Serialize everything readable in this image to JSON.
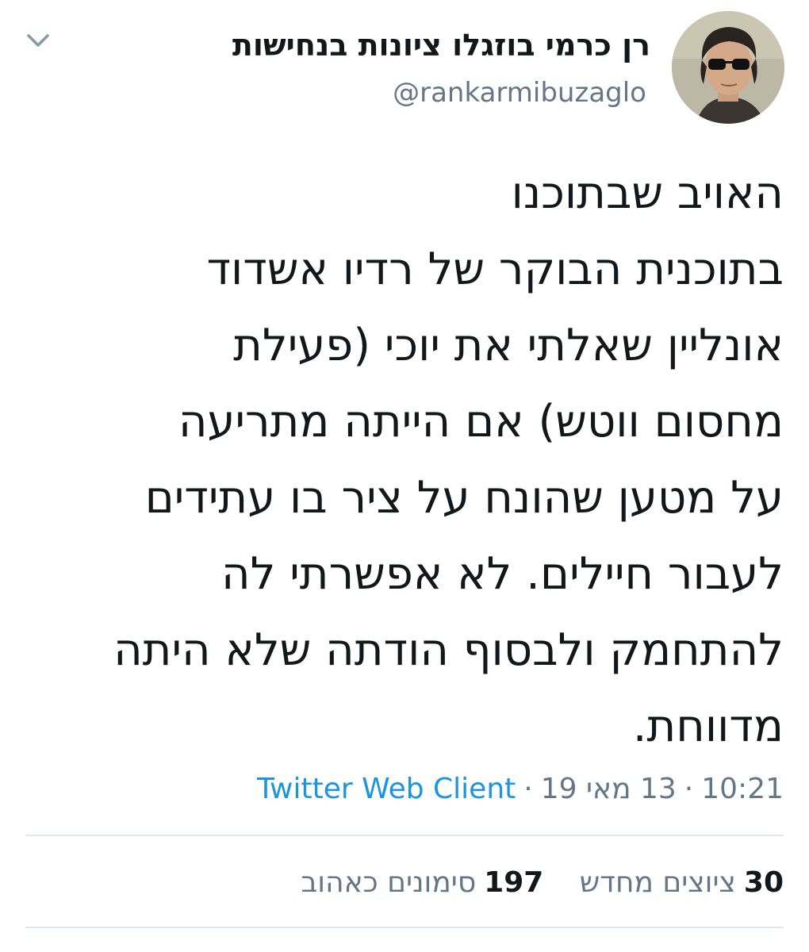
{
  "author": {
    "display_name": "רן כרמי בוזגלו ציונות בנחישות",
    "handle": "@rankarmibuzaglo",
    "avatar_icon": "profile-photo"
  },
  "tweet": {
    "lines": [
      "האויב שבתוכנו",
      "בתוכנית הבוקר של רדיו אשדוד",
      "אונליין שאלתי את יוכי (פעילת",
      "מחסום ווטש) אם הייתה מתריעה",
      "על מטען שהונח על ציר בו עתידים",
      "לעבור חיילים. לא אפשרתי לה",
      "להתחמק ולבסוף הודתה שלא היתה",
      "מדווחת."
    ]
  },
  "meta": {
    "time": "10:21",
    "date": "13 מאי 19",
    "separator": "·",
    "client": "Twitter Web Client"
  },
  "stats": {
    "retweets_count": "30",
    "retweets_label": "ציוצים מחדש",
    "likes_count": "197",
    "likes_label": "סימונים כאהוב"
  },
  "icons": {
    "more_options": "chevron-down-icon"
  },
  "colors": {
    "text": "#14171a",
    "secondary": "#657786",
    "link": "#1b95e0",
    "divider": "#e1e8ed"
  }
}
